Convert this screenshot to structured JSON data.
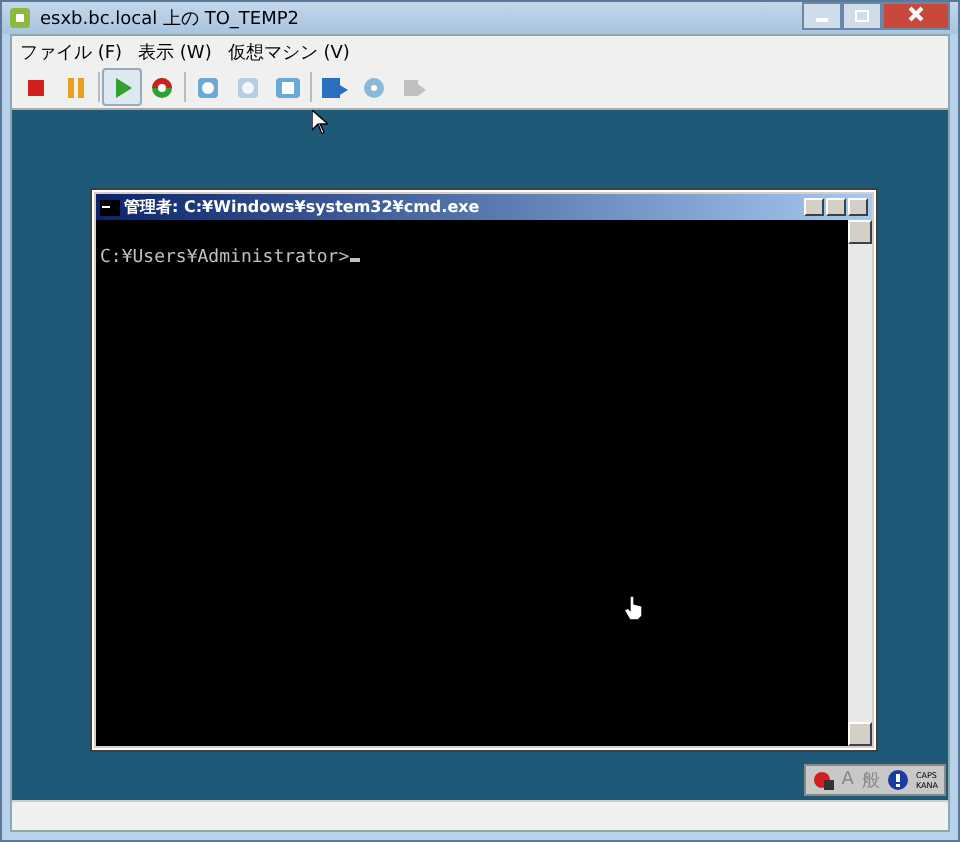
{
  "window": {
    "title": "esxb.bc.local 上の TO_TEMP2"
  },
  "menu": [
    "ファイル (F)",
    "表示 (W)",
    "仮想マシン (V)"
  ],
  "toolbar": [
    {
      "kind": "stop",
      "pressed": false,
      "disabled": false
    },
    {
      "kind": "pause",
      "pressed": false,
      "disabled": false
    },
    {
      "kind": "play",
      "pressed": true,
      "disabled": false
    },
    {
      "kind": "reset",
      "pressed": false,
      "disabled": false
    },
    {
      "kind": "snapshot",
      "pressed": false,
      "disabled": false
    },
    {
      "kind": "snapshot",
      "pressed": false,
      "disabled": true
    },
    {
      "kind": "snapshot-manager",
      "pressed": false,
      "disabled": false
    },
    {
      "kind": "disk",
      "pressed": false,
      "disabled": false
    },
    {
      "kind": "cd",
      "pressed": false,
      "disabled": false
    },
    {
      "kind": "device",
      "pressed": false,
      "disabled": true
    }
  ],
  "console": {
    "title": "管理者: C:¥Windows¥system32¥cmd.exe",
    "lines": [
      "C:¥Users¥Administrator>"
    ]
  },
  "language_bar": {
    "mode": "A",
    "input": "般",
    "caps": "CAPS",
    "kana": "KANA"
  }
}
